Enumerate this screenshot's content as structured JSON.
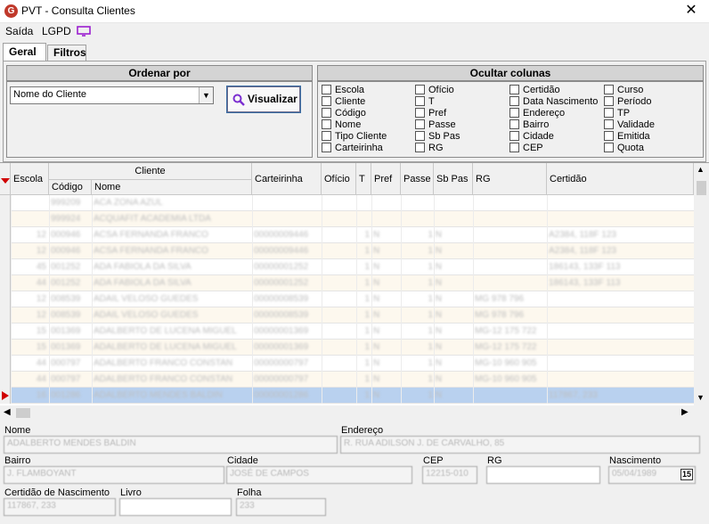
{
  "window": {
    "title": "PVT - Consulta Clientes",
    "close": "✕",
    "icon_letter": "G"
  },
  "menu": {
    "items": [
      "Saída",
      "LGPD"
    ]
  },
  "tabs": [
    "Geral",
    "Filtros"
  ],
  "order": {
    "header": "Ordenar por",
    "selected": "Nome do Cliente",
    "button": "Visualizar"
  },
  "hide_columns": {
    "header": "Ocultar colunas",
    "col1": [
      "Escola",
      "Cliente",
      "Código",
      "Nome",
      "Tipo Cliente",
      "Carteirinha"
    ],
    "col2": [
      "Ofício",
      "T",
      "Pref",
      "Passe",
      "Sb Pas",
      "RG"
    ],
    "col3": [
      "Certidão",
      "Data Nascimento",
      "Endereço",
      "Bairro",
      "Cidade",
      "CEP"
    ],
    "col4": [
      "Curso",
      "Período",
      "TP",
      "Validade",
      "Emitida",
      "Quota"
    ]
  },
  "grid": {
    "headers": {
      "escola": "Escola",
      "cliente": "Cliente",
      "codigo": "Código",
      "nome": "Nome",
      "carteirinha": "Carteirinha",
      "oficio": "Ofício",
      "t": "T",
      "pref": "Pref",
      "passe": "Passe",
      "sbpas": "Sb Pas",
      "rg": "RG",
      "certidao": "Certidão"
    },
    "rows": [
      {
        "escola": "",
        "codigo": "999209",
        "nome": "ACA ZONA AZUL",
        "cart": "",
        "t": "",
        "pref": "",
        "passe": "",
        "rg": "",
        "cert": ""
      },
      {
        "escola": "",
        "codigo": "999924",
        "nome": "ACQUAFIT ACADEMIA LTDA",
        "cart": "",
        "t": "",
        "pref": "",
        "passe": "",
        "rg": "",
        "cert": ""
      },
      {
        "escola": "12",
        "codigo": "000946",
        "nome": "ACSA FERNANDA FRANCO",
        "cart": "00000009446",
        "t": "1",
        "pref": "N",
        "passe": "1 N",
        "rg": "",
        "cert": "A2384, 118F 123"
      },
      {
        "escola": "12",
        "codigo": "000946",
        "nome": "ACSA FERNANDA FRANCO",
        "cart": "00000009446",
        "t": "1",
        "pref": "N",
        "passe": "1 N",
        "rg": "",
        "cert": "A2384, 118F 123"
      },
      {
        "escola": "45",
        "codigo": "001252",
        "nome": "ADA FABIOLA DA SILVA",
        "cart": "00000001252",
        "t": "1",
        "pref": "N",
        "passe": "1 N",
        "rg": "",
        "cert": "186143, 133F 113"
      },
      {
        "escola": "44",
        "codigo": "001252",
        "nome": "ADA FABIOLA DA SILVA",
        "cart": "00000001252",
        "t": "1",
        "pref": "N",
        "passe": "1 N",
        "rg": "",
        "cert": "186143, 133F 113"
      },
      {
        "escola": "12",
        "codigo": "008539",
        "nome": "ADAIL VELOSO GUEDES",
        "cart": "00000008539",
        "t": "1",
        "pref": "N",
        "passe": "1 N",
        "rg": "MG 978 796",
        "cert": ""
      },
      {
        "escola": "12",
        "codigo": "008539",
        "nome": "ADAIL VELOSO GUEDES",
        "cart": "00000008539",
        "t": "1",
        "pref": "N",
        "passe": "1 N",
        "rg": "MG 978 796",
        "cert": ""
      },
      {
        "escola": "15",
        "codigo": "001369",
        "nome": "ADALBERTO DE LUCENA MIGUEL",
        "cart": "00000001369",
        "t": "1",
        "pref": "N",
        "passe": "1 N",
        "rg": "MG-12 175 722",
        "cert": ""
      },
      {
        "escola": "15",
        "codigo": "001369",
        "nome": "ADALBERTO DE LUCENA MIGUEL",
        "cart": "00000001369",
        "t": "1",
        "pref": "N",
        "passe": "1 N",
        "rg": "MG-12 175 722",
        "cert": ""
      },
      {
        "escola": "44",
        "codigo": "000797",
        "nome": "ADALBERTO FRANCO CONSTAN",
        "cart": "00000000797",
        "t": "1",
        "pref": "N",
        "passe": "1 N",
        "rg": "MG-10 960 905",
        "cert": ""
      },
      {
        "escola": "44",
        "codigo": "000797",
        "nome": "ADALBERTO FRANCO CONSTAN",
        "cart": "00000000797",
        "t": "1",
        "pref": "N",
        "passe": "1 N",
        "rg": "MG-10 960 905",
        "cert": ""
      },
      {
        "escola": "16",
        "codigo": "001286",
        "nome": "ADALBERTO MENDES BALDIN",
        "cart": "00000001286",
        "t": "1",
        "pref": "N",
        "passe": "1 N",
        "rg": "",
        "cert": "117867, 233"
      }
    ]
  },
  "detail": {
    "nome_label": "Nome",
    "nome": "ADALBERTO MENDES BALDIN",
    "endereco_label": "Endereço",
    "endereco": "R. RUA ADILSON J. DE CARVALHO, 85",
    "bairro_label": "Bairro",
    "bairro": "J. FLAMBOYANT",
    "cidade_label": "Cidade",
    "cidade": "JOSÉ DE CAMPOS",
    "cep_label": "CEP",
    "cep": "12215-010",
    "rg_label": "RG",
    "rg": "",
    "nasc_label": "Nascimento",
    "nasc": "05/04/1989",
    "certnasc_label": "Certidão de Nascimento",
    "certnasc": "117867, 233",
    "livro_label": "Livro",
    "livro": "",
    "folha_label": "Folha",
    "folha": "233",
    "calendar_button": "15"
  }
}
